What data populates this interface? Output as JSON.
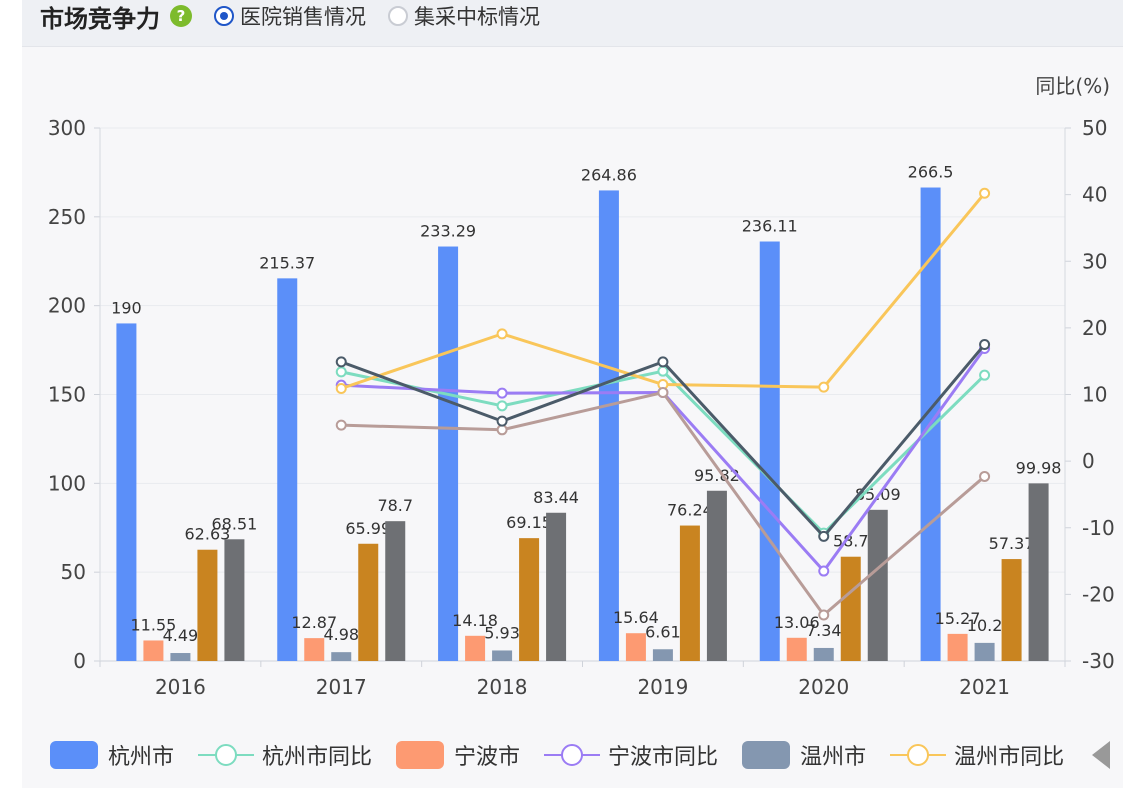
{
  "header": {
    "title": "市场竞争力",
    "help_icon": "help-icon",
    "radios": [
      {
        "label": "医院销售情况",
        "checked": true
      },
      {
        "label": "集采中标情况",
        "checked": false
      }
    ]
  },
  "colors": {
    "hz_bar": "#5b8ff9",
    "nb_bar": "#fd9a72",
    "wz_bar": "#8497b0",
    "s4_bar": "#c98420",
    "s5_bar": "#6e7074",
    "hz_line": "#7ddcc0",
    "nb_line": "#9b7cf4",
    "wz_line": "#f9c65a",
    "s4_line": "#b89c98",
    "s5_line": "#4b5b69"
  },
  "chart_data": {
    "type": "bar",
    "categories": [
      "2016",
      "2017",
      "2018",
      "2019",
      "2020",
      "2021"
    ],
    "y_left": {
      "min": 0,
      "max": 300,
      "ticks": [
        0,
        50,
        100,
        150,
        200,
        250,
        300
      ]
    },
    "y_right": {
      "label": "同比(%)",
      "min": -30,
      "max": 50,
      "ticks": [
        -30,
        -20,
        -10,
        0,
        10,
        20,
        30,
        40,
        50
      ]
    },
    "bar_series": [
      {
        "name": "杭州市",
        "color_key": "hz_bar",
        "values": [
          190,
          215.37,
          233.29,
          264.86,
          236.11,
          266.5
        ],
        "labels": [
          "190",
          "215.37",
          "233.29",
          "264.86",
          "236.11",
          "266.5"
        ]
      },
      {
        "name": "宁波市",
        "color_key": "nb_bar",
        "values": [
          11.55,
          12.87,
          14.18,
          15.64,
          13.06,
          15.27
        ],
        "labels": [
          "11.55",
          "12.87",
          "14.18",
          "15.64",
          "13.06",
          "15.27"
        ]
      },
      {
        "name": "温州市",
        "color_key": "wz_bar",
        "values": [
          4.49,
          4.98,
          5.93,
          6.61,
          7.34,
          10.2
        ],
        "labels": [
          "4.49",
          "4.98",
          "5.93",
          "6.61",
          "7.34",
          "10.2"
        ]
      },
      {
        "color_key": "s4_bar",
        "values": [
          62.63,
          65.99,
          69.15,
          76.24,
          58.7,
          57.37
        ],
        "labels": [
          "62.63",
          "65.99",
          "69.15",
          "76.24",
          "58.7",
          "57.37"
        ]
      },
      {
        "color_key": "s5_bar",
        "values": [
          68.51,
          78.7,
          83.44,
          95.82,
          85.09,
          99.98
        ],
        "labels": [
          "68.51",
          "78.7",
          "83.44",
          "95.82",
          "85.09",
          "99.98"
        ]
      }
    ],
    "line_series": [
      {
        "name": "杭州市同比",
        "color_key": "hz_line",
        "values": [
          null,
          13.4,
          8.3,
          13.5,
          -10.8,
          12.9
        ]
      },
      {
        "name": "宁波市同比",
        "color_key": "nb_line",
        "values": [
          null,
          11.4,
          10.2,
          10.3,
          -16.5,
          16.9
        ]
      },
      {
        "name": "温州市同比",
        "color_key": "wz_line",
        "values": [
          null,
          10.9,
          19.1,
          11.5,
          11.1,
          40.2
        ]
      },
      {
        "color_key": "s4_line",
        "values": [
          null,
          5.4,
          4.7,
          10.3,
          -23.1,
          -2.3
        ]
      },
      {
        "color_key": "s5_line",
        "values": [
          null,
          14.9,
          6.0,
          14.9,
          -11.3,
          17.5
        ]
      }
    ],
    "legend": [
      {
        "name": "杭州市",
        "kind": "bar",
        "color_key": "hz_bar"
      },
      {
        "name": "杭州市同比",
        "kind": "line",
        "color_key": "hz_line"
      },
      {
        "name": "宁波市",
        "kind": "bar",
        "color_key": "nb_bar"
      },
      {
        "name": "宁波市同比",
        "kind": "line",
        "color_key": "nb_line"
      },
      {
        "name": "温州市",
        "kind": "bar",
        "color_key": "wz_bar"
      },
      {
        "name": "温州市同比",
        "kind": "line",
        "color_key": "wz_line"
      }
    ]
  }
}
